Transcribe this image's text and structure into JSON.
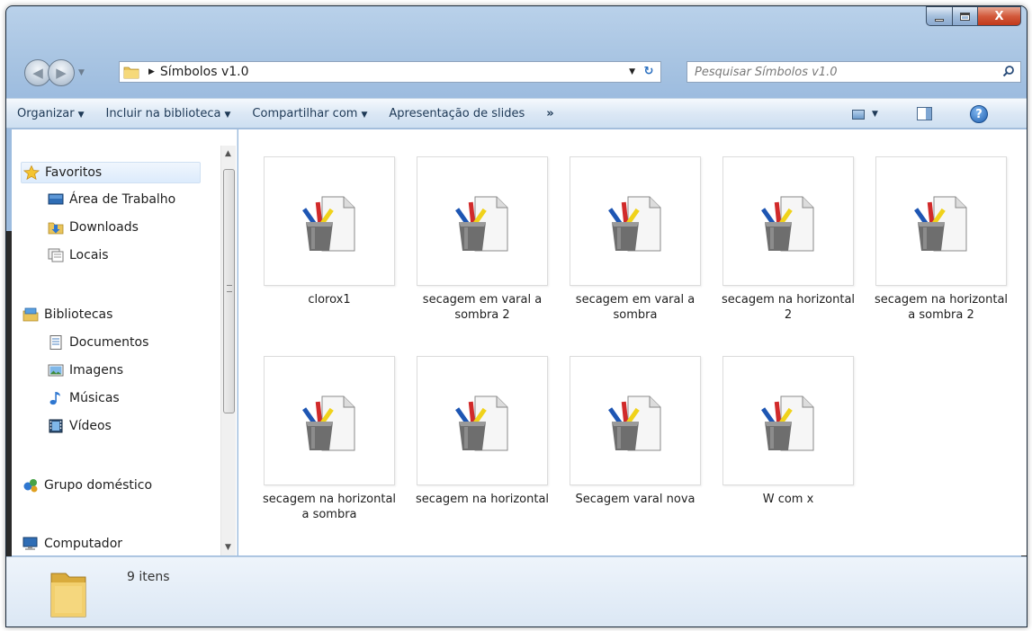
{
  "window": {
    "controls": {
      "minimize": "–",
      "maximize": "□",
      "close": "X"
    }
  },
  "address": {
    "path": "Símbolos v1.0",
    "search_placeholder": "Pesquisar Símbolos v1.0"
  },
  "toolbar": {
    "organize": "Organizar",
    "include_library": "Incluir na biblioteca",
    "share_with": "Compartilhar com",
    "slideshow": "Apresentação de slides",
    "more": "»"
  },
  "nav": {
    "favorites": {
      "label": "Favoritos",
      "icon": "star-icon"
    },
    "favorites_items": [
      {
        "label": "Área de Trabalho",
        "icon": "desktop-icon"
      },
      {
        "label": "Downloads",
        "icon": "downloads-folder-icon"
      },
      {
        "label": "Locais",
        "icon": "places-icon"
      }
    ],
    "libraries": {
      "label": "Bibliotecas",
      "icon": "libraries-icon"
    },
    "libraries_items": [
      {
        "label": "Documentos",
        "icon": "documents-icon"
      },
      {
        "label": "Imagens",
        "icon": "images-icon"
      },
      {
        "label": "Músicas",
        "icon": "music-icon"
      },
      {
        "label": "Vídeos",
        "icon": "videos-icon"
      }
    ],
    "homegroup": {
      "label": "Grupo doméstico",
      "icon": "homegroup-icon"
    },
    "computer": {
      "label": "Computador",
      "icon": "computer-icon"
    }
  },
  "files": [
    {
      "name": "clorox1"
    },
    {
      "name": "secagem em varal a sombra 2"
    },
    {
      "name": "secagem em varal a sombra"
    },
    {
      "name": "secagem na horizontal 2"
    },
    {
      "name": "secagem na horizontal a sombra 2"
    },
    {
      "name": "secagem na horizontal a sombra"
    },
    {
      "name": "secagem na horizontal"
    },
    {
      "name": "Secagem varal nova"
    },
    {
      "name": "W com x"
    }
  ],
  "status": {
    "item_count": "9 itens"
  }
}
